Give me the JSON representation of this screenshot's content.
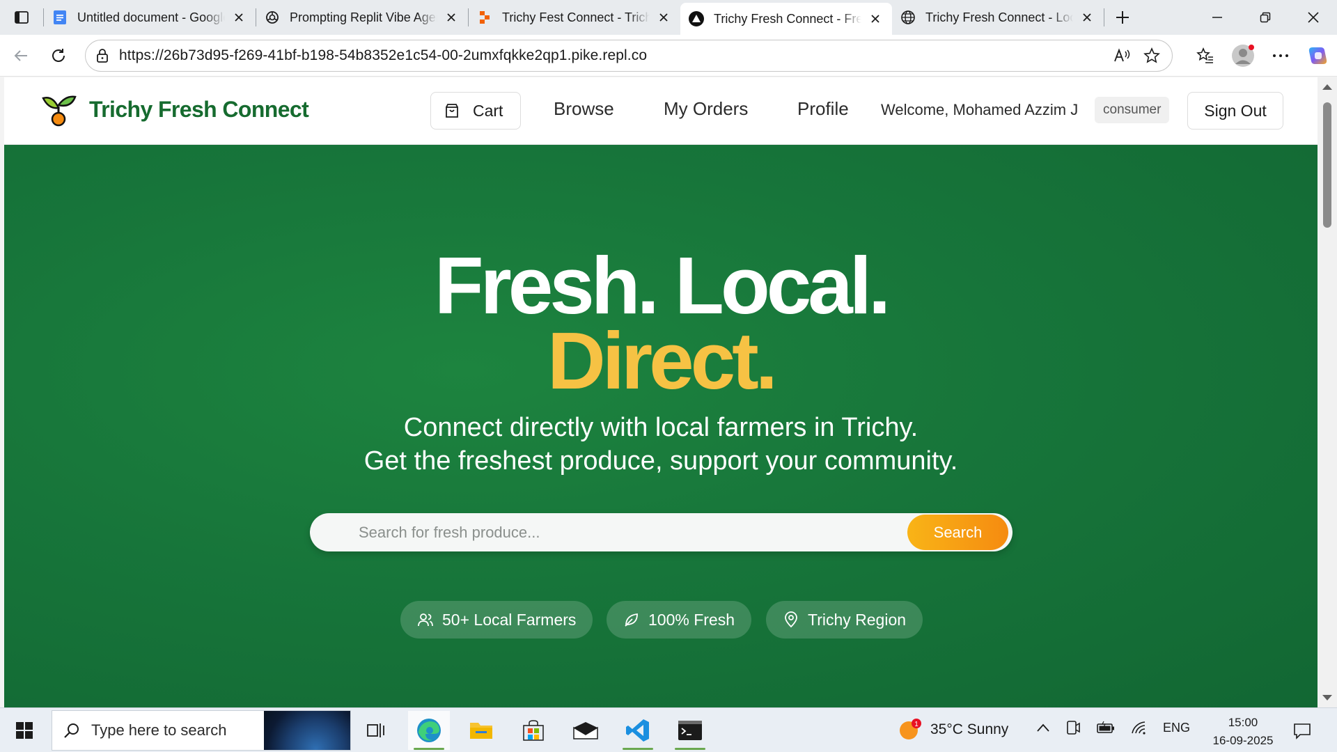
{
  "browser": {
    "tabs": [
      {
        "title": "Untitled document - Google Docs",
        "icon": "docs-icon"
      },
      {
        "title": "Prompting Replit Vibe Agent",
        "icon": "openai-icon"
      },
      {
        "title": "Trichy Fest Connect - Trichy",
        "icon": "replit-icon"
      },
      {
        "title": "Trichy Fresh Connect - Fresh",
        "icon": "app-icon",
        "active": true
      },
      {
        "title": "Trichy Fresh Connect - Local",
        "icon": "globe-icon"
      }
    ],
    "url": "https://26b73d95-f269-41bf-b198-54b8352e1c54-00-2umxfqkke2qp1.pike.repl.co"
  },
  "site": {
    "brand": "Trichy Fresh Connect",
    "nav": {
      "cart": "Cart",
      "browse": "Browse",
      "orders": "My Orders",
      "profile": "Profile",
      "welcome": "Welcome, Mohamed Azzim J",
      "role": "consumer",
      "sign_out": "Sign Out"
    },
    "hero": {
      "line1": "Fresh. Local.",
      "line2": "Direct.",
      "sub1": "Connect directly with local farmers in Trichy.",
      "sub2": "Get the freshest produce, support your community.",
      "search_placeholder": "Search for fresh produce...",
      "search_button": "Search",
      "pills": [
        {
          "label": "50+ Local Farmers",
          "icon": "users-icon"
        },
        {
          "label": "100% Fresh",
          "icon": "leaf-icon"
        },
        {
          "label": "Trichy Region",
          "icon": "map-pin-icon"
        }
      ]
    },
    "colors": {
      "brand_green": "#166b2f",
      "hero_green": "#17753a",
      "accent_yellow": "#f6c244",
      "search_orange": "#f58b10"
    }
  },
  "taskbar": {
    "search_placeholder": "Type here to search",
    "weather": "35°C  Sunny",
    "weather_badge": "1",
    "lang": "ENG",
    "time": "15:00",
    "date": "16-09-2025"
  }
}
